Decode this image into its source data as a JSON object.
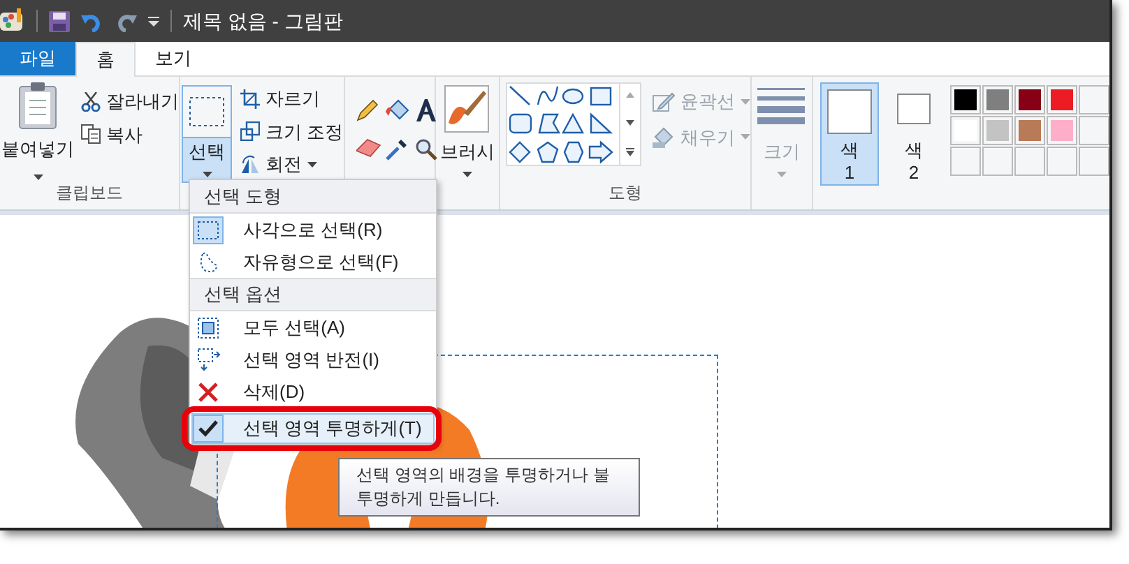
{
  "window": {
    "title": "제목 없음 - 그림판"
  },
  "tabs": [
    {
      "label": "파일",
      "kind": "file",
      "selected": false
    },
    {
      "label": "홈",
      "kind": "tab",
      "selected": true
    },
    {
      "label": "보기",
      "kind": "tab",
      "selected": false
    }
  ],
  "clipboard": {
    "paste": "붙여넣기",
    "cut": "잘라내기",
    "copy": "복사",
    "label": "클립보드"
  },
  "image": {
    "select": "선택",
    "select_open": true,
    "crop": "자르기",
    "resize": "크기 조정",
    "rotate": "회전"
  },
  "brushes": {
    "label": "브러시"
  },
  "shapes": {
    "label": "도형",
    "outline": {
      "label": "윤곽선",
      "disabled": true
    },
    "fill": {
      "label": "채우기",
      "disabled": true
    }
  },
  "size": {
    "label": "크기",
    "disabled": true
  },
  "colors": [
    {
      "label": "색",
      "number": "1",
      "selected": true
    },
    {
      "label": "색",
      "number": "2",
      "selected": false
    }
  ],
  "palette": [
    {
      "color": "#000000"
    },
    {
      "color": "#7f7f7f"
    },
    {
      "color": "#880015"
    },
    {
      "color": "#ed1c24"
    },
    {
      "color": "#ffffff"
    },
    {
      "color": "#c3c3c3"
    },
    {
      "color": "#b97a57"
    },
    {
      "color": "#ffaec9"
    }
  ],
  "select_menu": {
    "sections": [
      {
        "heading": "선택 도형",
        "items": [
          {
            "kind": "rectangle",
            "label": "사각으로 선택(R)",
            "selected": true,
            "annotated": false
          },
          {
            "kind": "freeform",
            "label": "자유형으로 선택(F)",
            "selected": false,
            "annotated": false
          }
        ]
      },
      {
        "heading": "선택 옵션",
        "items": [
          {
            "kind": "all",
            "label": "모두 선택(A)",
            "selected": false,
            "annotated": false
          },
          {
            "kind": "invert",
            "label": "선택 영역 반전(I)",
            "selected": false,
            "annotated": false
          },
          {
            "kind": "delete",
            "label": "삭제(D)",
            "selected": false,
            "annotated": false
          },
          {
            "kind": "check",
            "label": "선택 영역 투명하게(T)",
            "selected": true,
            "annotated": true
          }
        ]
      }
    ]
  },
  "tooltip": {
    "lines": [
      "선택 영역의 배경을 투명하거나 불",
      "투명하게 만듭니다."
    ]
  }
}
